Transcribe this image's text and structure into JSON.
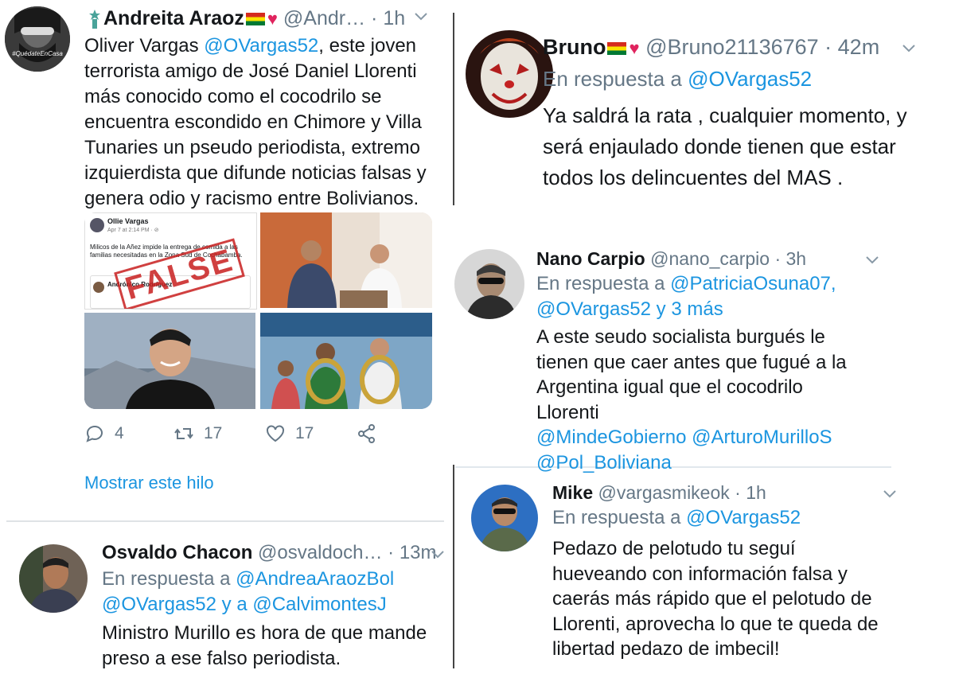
{
  "tweet1": {
    "name": "Andreita Araoz",
    "handle": "@Andr…",
    "time": "· 1h",
    "avatar_badge": "#QuédateEnCasa",
    "body_prefix": "Oliver Vargas ",
    "body_mention": "@OVargas52",
    "body_rest": ", este joven terrorista amigo de José Daniel Llorenti más conocido como el cocodrilo se encuentra escondido en Chimore y Villa Tunaries un pseudo periodista, extremo izquierdista que difunde noticias falsas y genera odio y racismo entre Bolivianos.",
    "embedded_post": {
      "author": "Ollie Vargas",
      "date": "Apr 7 at 2:14 PM · ⊘",
      "text": "Milicos de la Añez impide la entrega de comida a las familias necesitadas en la Zona Sud de Cochabamba.",
      "quoted_author": "Andrónico Rodríguez",
      "stamp": "FALSE"
    },
    "replies_count": "4",
    "retweets_count": "17",
    "likes_count": "17",
    "show_thread": "Mostrar este hilo"
  },
  "tweet2": {
    "name": "Bruno",
    "handle": "@Bruno21136767",
    "time": "· 42m",
    "reply_prefix": "En respuesta a ",
    "reply_to": "@OVargas52",
    "body": "Ya saldrá la rata , cualquier momento,  y será enjaulado donde tienen que estar todos los delincuentes del MAS ."
  },
  "tweet3": {
    "name": "Nano Carpio",
    "handle": "@nano_carpio",
    "time": "· 3h",
    "reply_prefix": "En respuesta a ",
    "reply_to_1": "@PatriciaOsuna07,",
    "reply_to_2": "@OVargas52",
    "reply_more": " y 3 más",
    "body": "A este seudo socialista burgués le tienen que caer antes que fugué a la Argentina igual que el cocodrilo Llorenti",
    "mention_1": "@MindeGobierno",
    "mention_2": "@ArturoMurilloS",
    "mention_3": "@Pol_Boliviana"
  },
  "tweet4": {
    "name": "Mike",
    "handle": "@vargasmikeok",
    "time": "· 1h",
    "reply_prefix": "En respuesta a ",
    "reply_to": "@OVargas52",
    "body": "Pedazo de pelotudo tu seguí hueveando con información falsa y caerás más rápido que el pelotudo de Llorenti, aprovecha lo que te queda de libertad pedazo de imbecil!"
  },
  "tweet5": {
    "name": "Osvaldo Chacon",
    "handle": "@osvaldoch…",
    "time": "· 13m",
    "reply_prefix": "En respuesta a ",
    "reply_to_1": "@AndreaAraozBol",
    "reply_to_2": "@OVargas52",
    "reply_and": " y a ",
    "reply_to_3": "@CalvimontesJ",
    "body": "Ministro Murillo es hora de que mande preso a ese falso periodista."
  },
  "colors": {
    "link": "#1b95e0",
    "meta": "#657786",
    "text": "#14171a",
    "heart": "#e0245e"
  },
  "icons": [
    "reply-icon",
    "retweet-icon",
    "like-icon",
    "share-icon",
    "chevron-down-icon",
    "heart-icon",
    "bolivia-flag-icon"
  ]
}
